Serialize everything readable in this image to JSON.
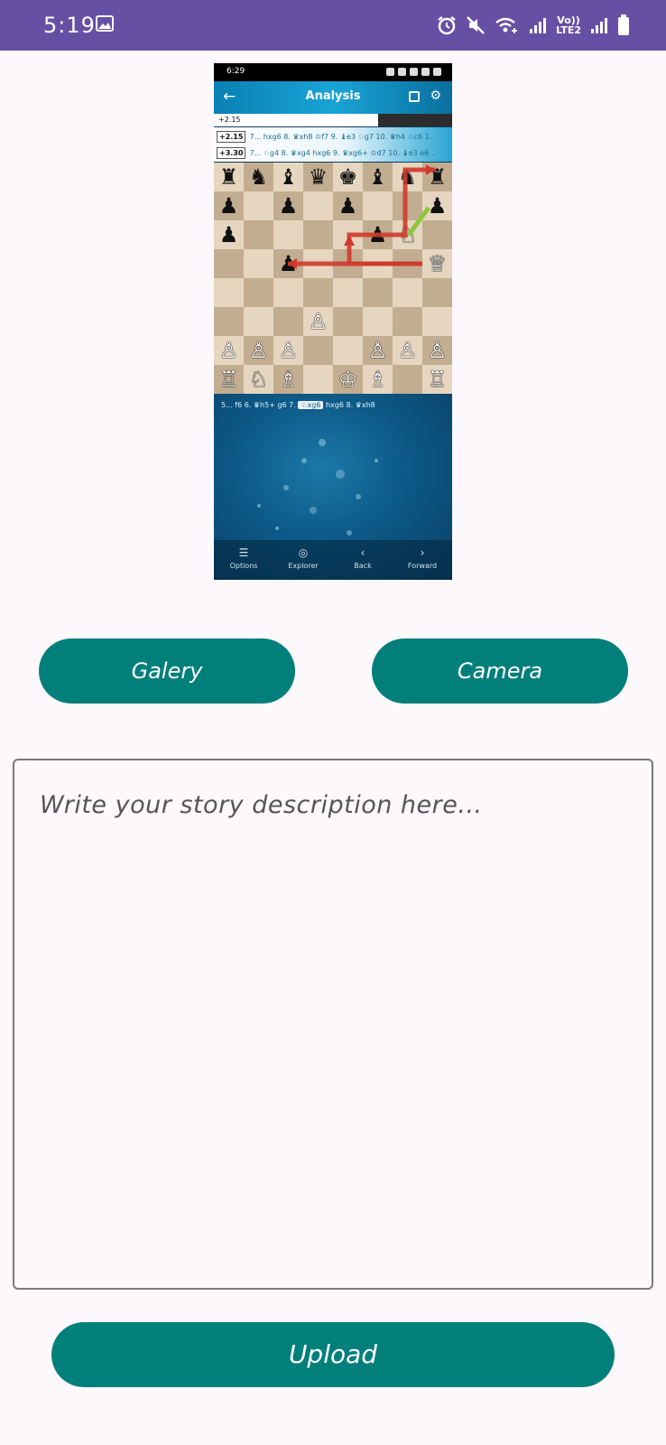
{
  "status_bar": {
    "time": "5:19",
    "lte_top": "Vo))",
    "lte_bottom": "LTE2",
    "icons": [
      "image-icon",
      "alarm-icon",
      "mute-icon",
      "wifi-icon",
      "signal-icon",
      "signal-icon",
      "battery-icon"
    ],
    "background": "#6750a4"
  },
  "preview": {
    "status_time": "6:29",
    "title": "Analysis",
    "eval_top": "+2.15",
    "eval_fill_fraction": 0.69,
    "lines": [
      {
        "badge": "+2.15",
        "moves": "7... hxg6 8. ♛xh8 ♔f7 9. ♝e3 ♘g7 10. ♛h4 ♘c6 1."
      },
      {
        "badge": "+3.30",
        "moves": "7... ♘g4 8. ♛xg4 hxg6 9. ♛xg6+ ♔d7 10. ♝e3 e6 .."
      }
    ],
    "board": [
      [
        "♜",
        "♞",
        "♝",
        "♛",
        "♚",
        "♝",
        "♞",
        "♜"
      ],
      [
        "♟",
        "",
        "♟",
        "",
        "♟",
        "",
        "",
        "♟"
      ],
      [
        "♟",
        "",
        "",
        "",
        "",
        "♟",
        "♘",
        ""
      ],
      [
        "",
        "",
        "♟",
        "",
        "",
        "",
        "",
        "♕"
      ],
      [
        "",
        "",
        "",
        "",
        "",
        "",
        "",
        ""
      ],
      [
        "",
        "",
        "",
        "♙",
        "",
        "",
        "",
        ""
      ],
      [
        "♙",
        "♙",
        "♙",
        "",
        "",
        "♙",
        "♙",
        "♙"
      ],
      [
        "♖",
        "♘",
        "♗",
        "",
        "♔",
        "♗",
        "",
        "♖"
      ]
    ],
    "board_colors": [
      "w",
      "w",
      "w",
      "w",
      "w",
      "w",
      "w",
      "w"
    ],
    "moves_line_before": "5... f6 6. ♛h5+ g6 7.",
    "moves_line_highlight": "♘xg6",
    "moves_line_after": "hxg6 8. ♛xh8",
    "nav": [
      {
        "icon": "list-icon",
        "glyph": "☰",
        "label": "Options"
      },
      {
        "icon": "compass-icon",
        "glyph": "◎",
        "label": "Explorer"
      },
      {
        "icon": "chevron-left-icon",
        "glyph": "‹",
        "label": "Back"
      },
      {
        "icon": "chevron-right-icon",
        "glyph": "›",
        "label": "Forward"
      }
    ]
  },
  "buttons": {
    "gallery": "Galery",
    "camera": "Camera",
    "upload": "Upload",
    "color": "#017f7b"
  },
  "story": {
    "placeholder": "Write your story description here..."
  }
}
